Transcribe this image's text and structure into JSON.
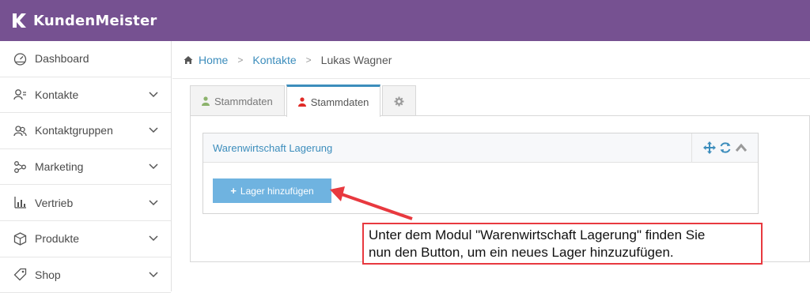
{
  "app": {
    "brand": "KundenMeister"
  },
  "sidebar": {
    "items": [
      {
        "label": "Dashboard",
        "icon": "gauge-icon",
        "expandable": false
      },
      {
        "label": "Kontakte",
        "icon": "contacts-icon",
        "expandable": true
      },
      {
        "label": "Kontaktgruppen",
        "icon": "group-icon",
        "expandable": true
      },
      {
        "label": "Marketing",
        "icon": "marketing-icon",
        "expandable": true
      },
      {
        "label": "Vertrieb",
        "icon": "bar-chart-icon",
        "expandable": true
      },
      {
        "label": "Produkte",
        "icon": "box-icon",
        "expandable": true
      },
      {
        "label": "Shop",
        "icon": "tag-icon",
        "expandable": true
      }
    ]
  },
  "breadcrumb": {
    "home": "Home",
    "contacts": "Kontakte",
    "current": "Lukas Wagner"
  },
  "tabs": [
    {
      "label": "Stammdaten",
      "icon": "user-icon",
      "icon_color": "#8cb36c"
    },
    {
      "label": "Stammdaten",
      "icon": "user-icon",
      "icon_color": "#e02b27"
    },
    {
      "label": "",
      "icon": "gear-icon"
    }
  ],
  "panel": {
    "title": "Warenwirtschaft Lagerung",
    "add_button": "Lager hinzufügen"
  },
  "callout": {
    "line1": "Unter dem Modul \"Warenwirtschaft Lagerung\" finden Sie",
    "line2": "nun den Button, um ein neues Lager hinzuzufügen."
  },
  "colors": {
    "topbar": "#765191",
    "link": "#3c8dbc",
    "button": "#6fb3e0",
    "callout_border": "#e8393f"
  }
}
